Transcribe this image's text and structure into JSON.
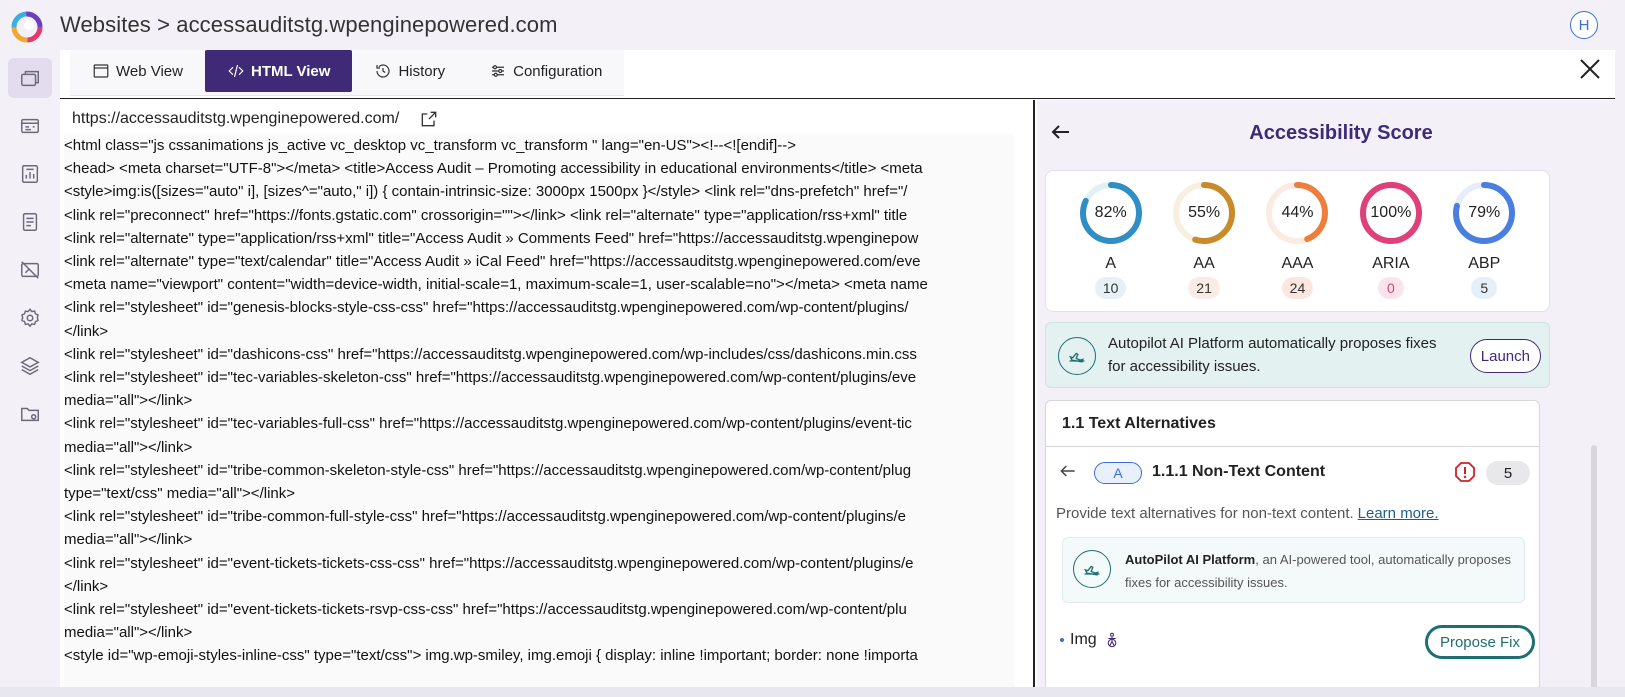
{
  "header": {
    "title": "Websites > accessauditstg.wpenginepowered.com",
    "avatar_initial": "H"
  },
  "sidebar": {
    "items": [
      {
        "icon": "windows-icon",
        "active": true
      },
      {
        "icon": "dashboard-card-icon",
        "active": false
      },
      {
        "icon": "report-chart-icon",
        "active": false
      },
      {
        "icon": "document-icon",
        "active": false
      },
      {
        "icon": "image-off-icon",
        "active": false
      },
      {
        "icon": "gear-icon",
        "active": false
      },
      {
        "icon": "layers-icon",
        "active": false
      },
      {
        "icon": "folder-settings-icon",
        "active": false
      }
    ]
  },
  "tabs": [
    {
      "label": "Web View",
      "icon": "browser-icon"
    },
    {
      "label": "HTML View",
      "icon": "code-icon",
      "active": true
    },
    {
      "label": "History",
      "icon": "history-icon"
    },
    {
      "label": "Configuration",
      "icon": "sliders-icon"
    }
  ],
  "code_view": {
    "url": "https://accessauditstg.wpenginepowered.com/",
    "lines": [
      "<html class=\"js cssanimations js_active vc_desktop vc_transform vc_transform \" lang=\"en-US\"><!--<![endif]-->",
      "<head> <meta charset=\"UTF-8\"></meta> <title>Access Audit – Promoting accessibility in educational environments</title> <meta",
      "<style>img:is([sizes=\"auto\" i], [sizes^=\"auto,\" i]) { contain-intrinsic-size: 3000px 1500px }</style> <link rel=\"dns-prefetch\" href=\"/",
      "<link rel=\"preconnect\" href=\"https://fonts.gstatic.com\" crossorigin=\"\"></link> <link rel=\"alternate\" type=\"application/rss+xml\" title",
      "<link rel=\"alternate\" type=\"application/rss+xml\" title=\"Access Audit » Comments Feed\" href=\"https://accessauditstg.wpenginepow",
      "<link rel=\"alternate\" type=\"text/calendar\" title=\"Access Audit » iCal Feed\" href=\"https://accessauditstg.wpenginepowered.com/eve",
      "<meta name=\"viewport\" content=\"width=device-width, initial-scale=1, maximum-scale=1, user-scalable=no\"></meta> <meta name",
      "<link rel=\"stylesheet\" id=\"genesis-blocks-style-css-css\" href=\"https://accessauditstg.wpenginepowered.com/wp-content/plugins/",
      "</link>",
      "<link rel=\"stylesheet\" id=\"dashicons-css\" href=\"https://accessauditstg.wpenginepowered.com/wp-includes/css/dashicons.min.css",
      "<link rel=\"stylesheet\" id=\"tec-variables-skeleton-css\" href=\"https://accessauditstg.wpenginepowered.com/wp-content/plugins/eve",
      "media=\"all\"></link>",
      "<link rel=\"stylesheet\" id=\"tec-variables-full-css\" href=\"https://accessauditstg.wpenginepowered.com/wp-content/plugins/event-tic",
      "media=\"all\"></link>",
      "<link rel=\"stylesheet\" id=\"tribe-common-skeleton-style-css\" href=\"https://accessauditstg.wpenginepowered.com/wp-content/plug",
      "type=\"text/css\" media=\"all\"></link>",
      "<link rel=\"stylesheet\" id=\"tribe-common-full-style-css\" href=\"https://accessauditstg.wpenginepowered.com/wp-content/plugins/e",
      "media=\"all\"></link>",
      "<link rel=\"stylesheet\" id=\"event-tickets-tickets-css-css\" href=\"https://accessauditstg.wpenginepowered.com/wp-content/plugins/e",
      "</link>",
      "<link rel=\"stylesheet\" id=\"event-tickets-tickets-rsvp-css-css\" href=\"https://accessauditstg.wpenginepowered.com/wp-content/plu",
      "media=\"all\"></link>",
      "<style id=\"wp-emoji-styles-inline-css\" type=\"text/css\"> img.wp-smiley, img.emoji { display: inline !important; border: none !importa"
    ]
  },
  "accessibility": {
    "title": "Accessibility Score",
    "scores": [
      {
        "name": "A",
        "percent": 82,
        "label": "82%",
        "count": "10",
        "color": "#2f8fc4",
        "track": "#e3eff7",
        "badge_bg": "#e6f0f7",
        "badge_fg": "#333"
      },
      {
        "name": "AA",
        "percent": 55,
        "label": "55%",
        "count": "21",
        "color": "#c98a2a",
        "track": "#f8efe0",
        "badge_bg": "#f8ece4",
        "badge_fg": "#333"
      },
      {
        "name": "AAA",
        "percent": 44,
        "label": "44%",
        "count": "24",
        "color": "#ef7d3c",
        "track": "#fbebe3",
        "badge_bg": "#fbe7df",
        "badge_fg": "#333"
      },
      {
        "name": "ARIA",
        "percent": 100,
        "label": "100%",
        "count": "0",
        "color": "#e0407a",
        "track": "#fbe3ec",
        "badge_bg": "#fbe3ec",
        "badge_fg": "#e0407a"
      },
      {
        "name": "ABP",
        "percent": 79,
        "label": "79%",
        "count": "5",
        "color": "#4a7fe0",
        "track": "#e5edfb",
        "badge_bg": "#e5eff8",
        "badge_fg": "#333"
      }
    ],
    "autopilot_banner": "Autopilot AI Platform automatically proposes fixes for accessibility issues.",
    "launch_label": "Launch",
    "section_title": "1.1 Text Alternatives",
    "criterion": {
      "level": "A",
      "name": "1.1.1 Non-Text Content",
      "issue_count": "5",
      "description": "Provide text alternatives for non-text content.",
      "learn_more": "Learn more."
    },
    "autopilot_small": {
      "brand": "AutoPilot AI Platform",
      "text": ", an AI-powered tool, automatically proposes fixes for accessibility issues."
    },
    "issue_item": {
      "label": "Img",
      "propose_label": "Propose Fix"
    }
  }
}
